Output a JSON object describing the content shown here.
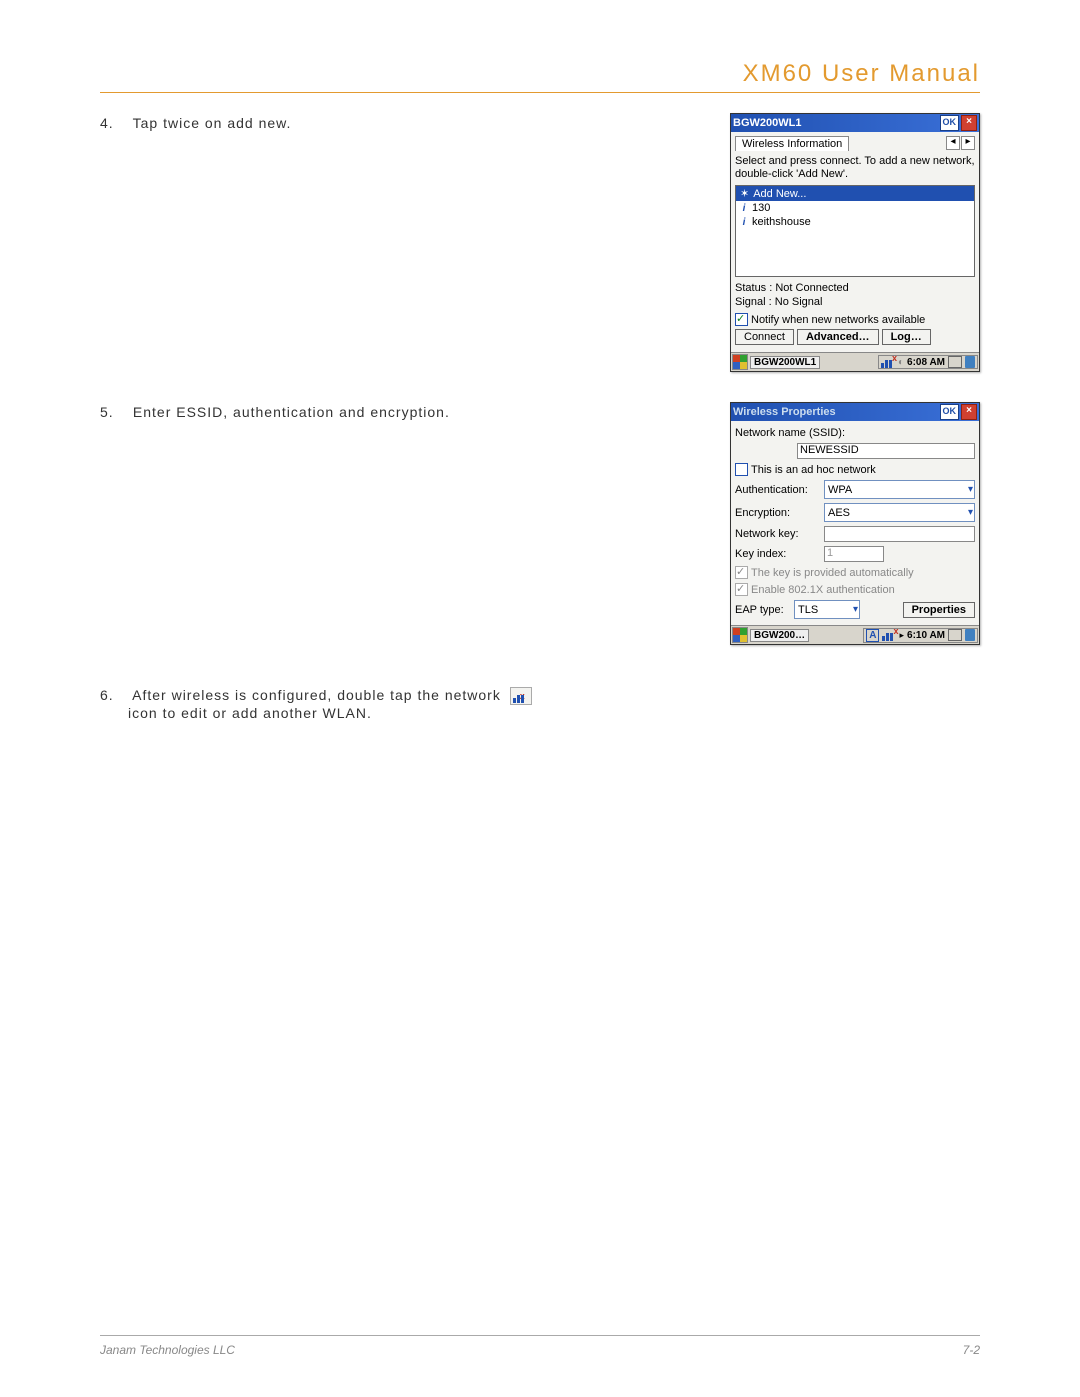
{
  "header": {
    "title": "XM60 User Manual"
  },
  "steps": {
    "s4": {
      "num": "4.",
      "text": "Tap twice on add new."
    },
    "s5": {
      "num": "5.",
      "text": "Enter ESSID, authentication and encryption."
    },
    "s6a": {
      "num": "6.",
      "text": "After wireless is configured, double tap the network"
    },
    "s6b": "icon to edit or add another WLAN."
  },
  "dlg1": {
    "title": "BGW200WL1",
    "ok": "OK",
    "tab": "Wireless Information",
    "instr": "Select and press connect.  To add a new network, double-click 'Add New'.",
    "list": {
      "addnew": "Add New...",
      "n1": "130",
      "n2": "keithshouse"
    },
    "status_lbl": "Status :",
    "status_val": "Not Connected",
    "signal_lbl": "Signal :",
    "signal_val": "No Signal",
    "notify": "Notify when new networks available",
    "btn_connect": "Connect",
    "btn_advanced": "Advanced…",
    "btn_log": "Log…",
    "task": "BGW200WL1",
    "clock": "6:08 AM"
  },
  "dlg2": {
    "title": "Wireless Properties",
    "ok": "OK",
    "ssid_lbl": "Network name (SSID):",
    "ssid_val": "NEWESSID",
    "adhoc": "This is an ad hoc network",
    "auth_lbl": "Authentication:",
    "auth_val": "WPA",
    "enc_lbl": "Encryption:",
    "enc_val": "AES",
    "key_lbl": "Network key:",
    "key_val": "",
    "idx_lbl": "Key index:",
    "idx_val": "1",
    "autokey": "The key is provided automatically",
    "dot1x": "Enable 802.1X authentication",
    "eap_lbl": "EAP type:",
    "eap_val": "TLS",
    "btn_props": "Properties",
    "task": "BGW200…",
    "clock": "6:10 AM",
    "ime": "A"
  },
  "footer": {
    "company": "Janam Technologies LLC",
    "page": "7-2"
  }
}
